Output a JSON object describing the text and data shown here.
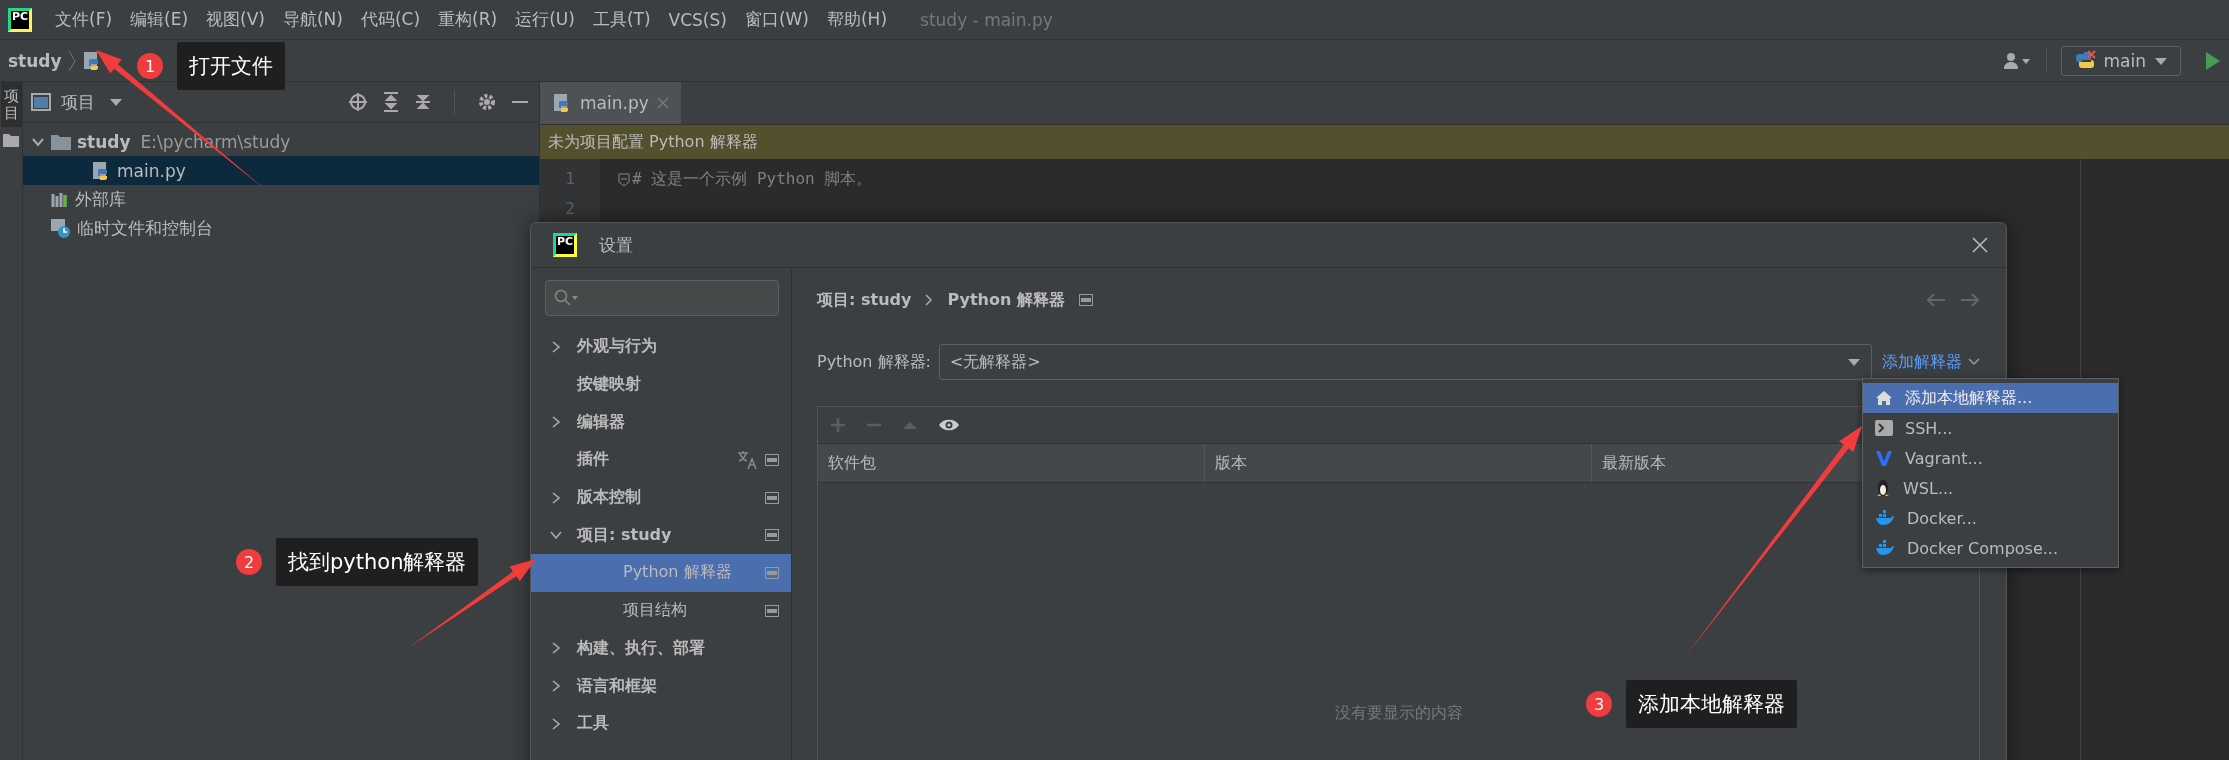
{
  "window": {
    "logo_text": "PC",
    "title": "study - main.py"
  },
  "menu": [
    "文件(F)",
    "编辑(E)",
    "视图(V)",
    "导航(N)",
    "代码(C)",
    "重构(R)",
    "运行(U)",
    "工具(T)",
    "VCS(S)",
    "窗口(W)",
    "帮助(H)"
  ],
  "breadcrumb": {
    "project": "study"
  },
  "toolbar": {
    "run_config": "main"
  },
  "side_tab": {
    "label": "项目",
    "selected": true
  },
  "project_panel": {
    "title": "项目",
    "tree": [
      {
        "label": "study",
        "path": "E:\\pycharm\\study",
        "kind": "folder",
        "expanded": true,
        "selected": false,
        "children": [
          {
            "label": "main.py",
            "kind": "python",
            "selected": true
          }
        ]
      },
      {
        "label": "外部库",
        "kind": "library",
        "selected": false
      },
      {
        "label": "临时文件和控制台",
        "kind": "scratch",
        "selected": false
      }
    ]
  },
  "editor": {
    "tabs": [
      {
        "label": "main.py",
        "selected": true
      }
    ],
    "banner": "未为项目配置 Python 解释器",
    "lines": [
      {
        "number": "1",
        "code": "# 这是一个示例 Python 脚本。"
      },
      {
        "number": "2"
      }
    ]
  },
  "dialog": {
    "logo_text": "PC",
    "title": "设置",
    "nav": [
      {
        "label": "外观与行为",
        "expanded": false,
        "selected": false
      },
      {
        "label": "按键映射",
        "selected": false
      },
      {
        "label": "编辑器",
        "expanded": false,
        "selected": false
      },
      {
        "label": "插件",
        "translated": true,
        "project_level": true,
        "selected": false
      },
      {
        "label": "版本控制",
        "expanded": false,
        "project_level": true,
        "selected": false
      },
      {
        "label": "项目: study",
        "expanded": true,
        "project_level": true,
        "selected": false,
        "children": [
          {
            "label": "Python 解释器",
            "project_level": true,
            "selected": true
          },
          {
            "label": "项目结构",
            "project_level": true,
            "selected": false
          }
        ]
      },
      {
        "label": "构建、执行、部署",
        "expanded": false,
        "selected": false
      },
      {
        "label": "语言和框架",
        "expanded": false,
        "selected": false
      },
      {
        "label": "工具",
        "expanded": false,
        "selected": false
      }
    ],
    "path": [
      "项目: study",
      "Python 解释器"
    ],
    "interpreter_label": "Python 解释器:",
    "interpreter_value": "<无解释器>",
    "add_link": "添加解释器",
    "columns": [
      "软件包",
      "版本",
      "最新版本"
    ],
    "empty_text": "没有要显示的内容",
    "add_menu": [
      {
        "label": "添加本地解释器...",
        "kind": "home",
        "selected": true
      },
      {
        "label": "SSH...",
        "kind": "terminal",
        "selected": false
      },
      {
        "label": "Vagrant...",
        "kind": "vagrant",
        "selected": false
      },
      {
        "label": "WSL...",
        "kind": "linux",
        "selected": false
      },
      {
        "label": "Docker...",
        "kind": "docker",
        "selected": false
      },
      {
        "label": "Docker Compose...",
        "kind": "docker",
        "selected": false
      }
    ]
  },
  "callouts": [
    {
      "number": "1",
      "label": "打开文件"
    },
    {
      "number": "2",
      "label": "找到python解释器"
    },
    {
      "number": "3",
      "label": "添加本地解释器"
    }
  ]
}
